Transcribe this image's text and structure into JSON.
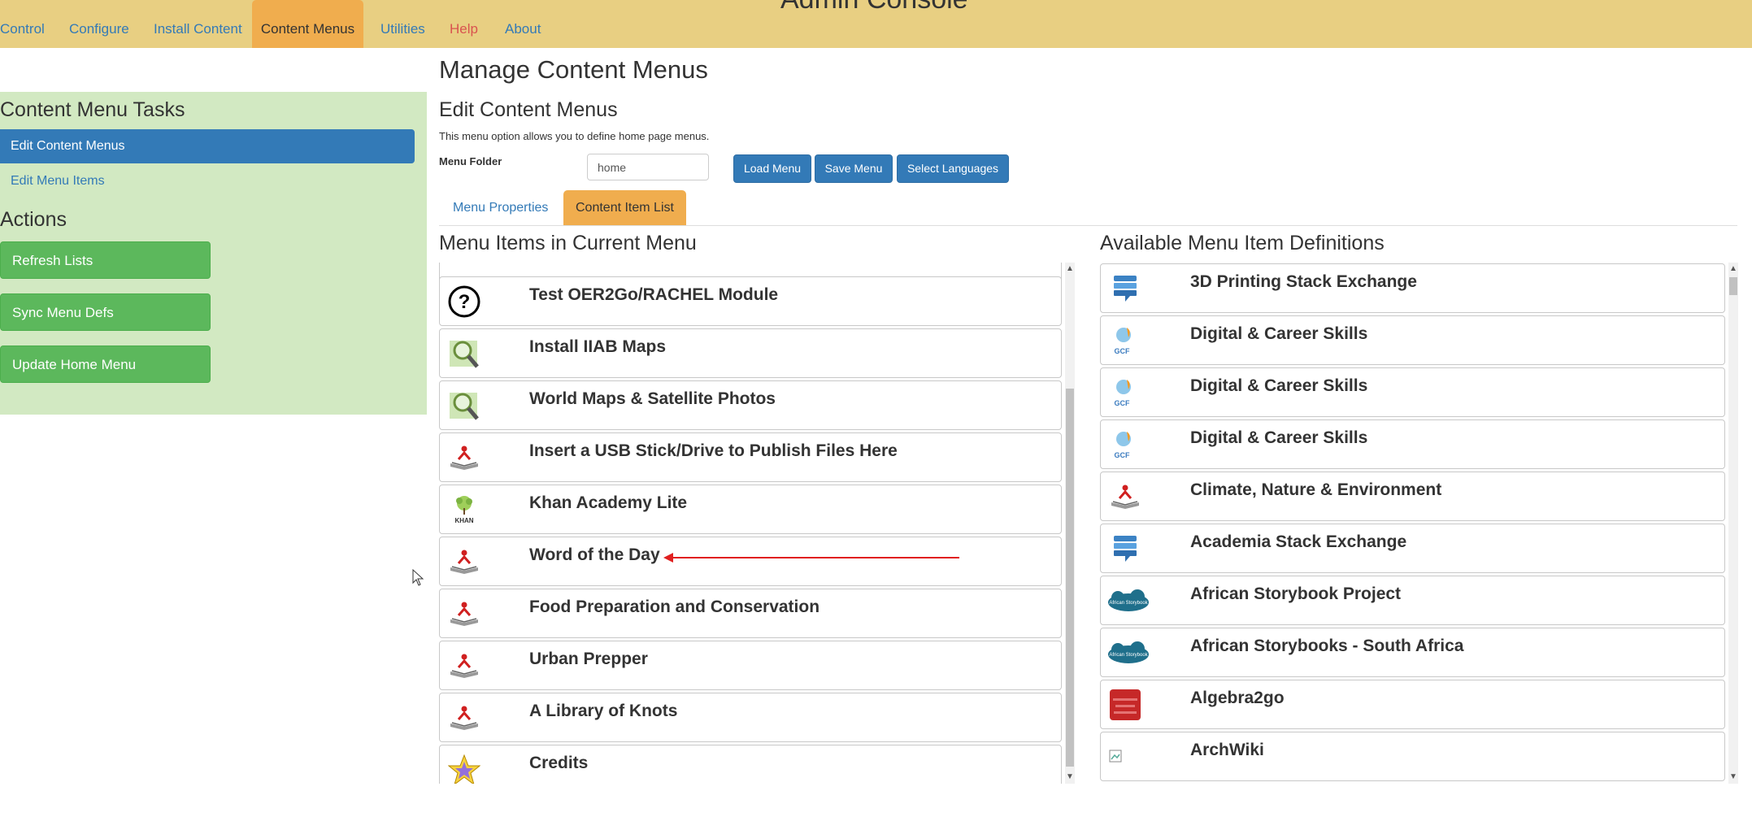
{
  "app": {
    "title": "Admin Console"
  },
  "nav": [
    {
      "label": "Control"
    },
    {
      "label": "Configure"
    },
    {
      "label": "Install Content"
    },
    {
      "label": "Content Menus",
      "active": true
    },
    {
      "label": "Utilities"
    },
    {
      "label": "Help"
    },
    {
      "label": "About"
    }
  ],
  "sidebar": {
    "tasks_heading": "Content Menu Tasks",
    "tasks": [
      {
        "label": "Edit Content Menus",
        "active": true
      },
      {
        "label": "Edit Menu Items"
      }
    ],
    "actions_heading": "Actions",
    "actions": [
      {
        "label": "Refresh Lists"
      },
      {
        "label": "Sync Menu Defs"
      },
      {
        "label": "Update Home Menu"
      }
    ]
  },
  "main": {
    "title": "Manage Content Menus",
    "subtitle": "Edit Content Menus",
    "help": "This menu option allows you to define home page menus.",
    "folder_label": "Menu Folder",
    "folder_value": "home",
    "buttons": {
      "load": "Load Menu",
      "save": "Save Menu",
      "languages": "Select Languages"
    },
    "tabs": [
      {
        "label": "Menu Properties"
      },
      {
        "label": "Content Item List",
        "active": true
      }
    ],
    "current_heading": "Menu Items in Current Menu",
    "available_heading": "Available Menu Item Definitions",
    "current_items": [
      {
        "label": "Test OER2Go/RACHEL Module",
        "icon": "question-circle-icon"
      },
      {
        "label": "Install IIAB Maps",
        "icon": "map-magnifier-icon"
      },
      {
        "label": "World Maps & Satellite Photos",
        "icon": "map-magnifier-icon"
      },
      {
        "label": "Insert a USB Stick/Drive to Publish Files Here",
        "icon": "book-reader-icon"
      },
      {
        "label": "Khan Academy Lite",
        "icon": "khan-tree-icon",
        "icon_text": "KHAN"
      },
      {
        "label": "Word of the Day",
        "icon": "book-reader-icon"
      },
      {
        "label": "Food Preparation and Conservation",
        "icon": "book-reader-icon"
      },
      {
        "label": "Urban Prepper",
        "icon": "book-reader-icon"
      },
      {
        "label": "A Library of Knots",
        "icon": "book-reader-icon"
      },
      {
        "label": "Credits",
        "icon": "star-icon"
      }
    ],
    "available_items": [
      {
        "label": "3D Printing Stack Exchange",
        "icon": "stack-exchange-icon"
      },
      {
        "label": "Digital & Career Skills",
        "icon": "gcf-icon",
        "icon_text": "GCF"
      },
      {
        "label": "Digital & Career Skills",
        "icon": "gcf-icon",
        "icon_text": "GCF"
      },
      {
        "label": "Digital & Career Skills",
        "icon": "gcf-icon",
        "icon_text": "GCF"
      },
      {
        "label": "Climate, Nature & Environment",
        "icon": "book-reader-icon"
      },
      {
        "label": "Academia Stack Exchange",
        "icon": "stack-exchange-icon"
      },
      {
        "label": "African Storybook Project",
        "icon": "african-storybook-icon",
        "icon_text": "African Storybook"
      },
      {
        "label": "African Storybooks - South Africa",
        "icon": "african-storybook-icon",
        "icon_text": "African Storybook"
      },
      {
        "label": "Algebra2go",
        "icon": "algebra2go-icon"
      },
      {
        "label": "ArchWiki",
        "icon": "broken-image-icon"
      }
    ]
  },
  "colors": {
    "navbar": "#e8cf82",
    "accent_orange": "#f0ad4e",
    "primary_blue": "#337ab7",
    "success_green": "#5cb85c",
    "sidebar_bg": "#d2e9c2",
    "annotation_red": "#e02020"
  }
}
